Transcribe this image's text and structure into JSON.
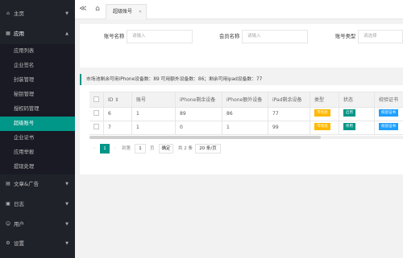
{
  "sidebar": {
    "items": [
      {
        "icon": "home-icon",
        "glyph": "⌂",
        "label": "主页",
        "arrow": "▼"
      },
      {
        "icon": "apps-icon",
        "glyph": "▦",
        "label": "应用",
        "arrow": "▲"
      },
      {
        "icon": "article-icon",
        "glyph": "▤",
        "label": "文章&广告",
        "arrow": "▼"
      },
      {
        "icon": "log-icon",
        "glyph": "▣",
        "label": "日志",
        "arrow": "▼"
      },
      {
        "icon": "user-icon",
        "glyph": "☺",
        "label": "用户",
        "arrow": "▼"
      },
      {
        "icon": "settings-icon",
        "glyph": "⚙",
        "label": "设置",
        "arrow": "▼"
      }
    ],
    "sub_items": [
      "应用列表",
      "企业签名",
      "封装管理",
      "秘钥管理",
      "授权码管理",
      "超级账号",
      "企业证书",
      "应用举报",
      "提现处理"
    ],
    "active_sub": "超级账号"
  },
  "topbar": {
    "collapse_glyph": "≪",
    "home_glyph": "⌂",
    "tab_label": "超级账号",
    "tab_close": "✕"
  },
  "filters": {
    "account_label": "账号名称",
    "account_placeholder": "请输入",
    "member_label": "会员名称",
    "member_placeholder": "请输入",
    "type_label": "账号类型",
    "type_placeholder": "请选择"
  },
  "notice": "市场池剩余可用iPhone设备数：89 可用额外设备数：86；剩余可用ipad设备数：77",
  "table": {
    "columns": [
      "ID ⇕",
      "账号",
      "iPhone剩余设备",
      "iPhone额外设备",
      "iPad剩余设备",
      "类型",
      "状态",
      "校验证书"
    ],
    "rows": [
      {
        "id": "6",
        "account": "1",
        "iphone_left": "89",
        "iphone_extra": "86",
        "ipad_left": "77",
        "type": "市场池",
        "status": "启用",
        "action": "校验证书"
      },
      {
        "id": "7",
        "account": "1",
        "iphone_left": "0",
        "iphone_extra": "1",
        "ipad_left": "99",
        "type": "市场池",
        "status": "停用",
        "action": "校验证书"
      }
    ]
  },
  "pagination": {
    "prev": "‹",
    "current_page": "1",
    "next": "›",
    "goto_label": "到第",
    "goto_value": "1",
    "page_unit": "页",
    "confirm": "确定",
    "total": "共 2 条",
    "page_size": "20 条/页"
  },
  "colors": {
    "sidebar_bg": "#20222a",
    "accent": "#009688",
    "badge_yellow": "#ffb800",
    "badge_blue": "#1e9fff"
  }
}
